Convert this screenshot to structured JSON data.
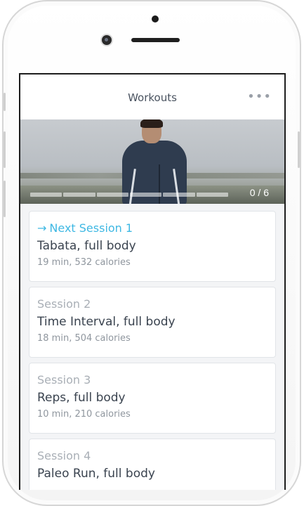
{
  "header": {
    "title": "Workouts",
    "more_icon": "more-horizontal-icon",
    "more_label": "•••"
  },
  "hero": {
    "progress_text": "0 / 6",
    "progress_completed": 0,
    "progress_total": 6
  },
  "sessions": [
    {
      "label": "Next Session 1",
      "prefix_icon": "arrow-right-icon",
      "arrow": "→",
      "name": "Tabata, full body",
      "meta": "19 min, 532 calories",
      "is_next": true
    },
    {
      "label": "Session 2",
      "name": "Time Interval, full body",
      "meta": "18 min, 504 calories"
    },
    {
      "label": "Session 3",
      "name": "Reps, full body",
      "meta": "10 min, 210 calories"
    },
    {
      "label": "Session 4",
      "name": "Paleo Run, full body",
      "meta": ""
    }
  ],
  "colors": {
    "accent": "#3eb8e3",
    "title_text": "#4a5360",
    "card_name": "#3a434f",
    "muted": "#a9afb6",
    "background": "#f3f4f6"
  }
}
